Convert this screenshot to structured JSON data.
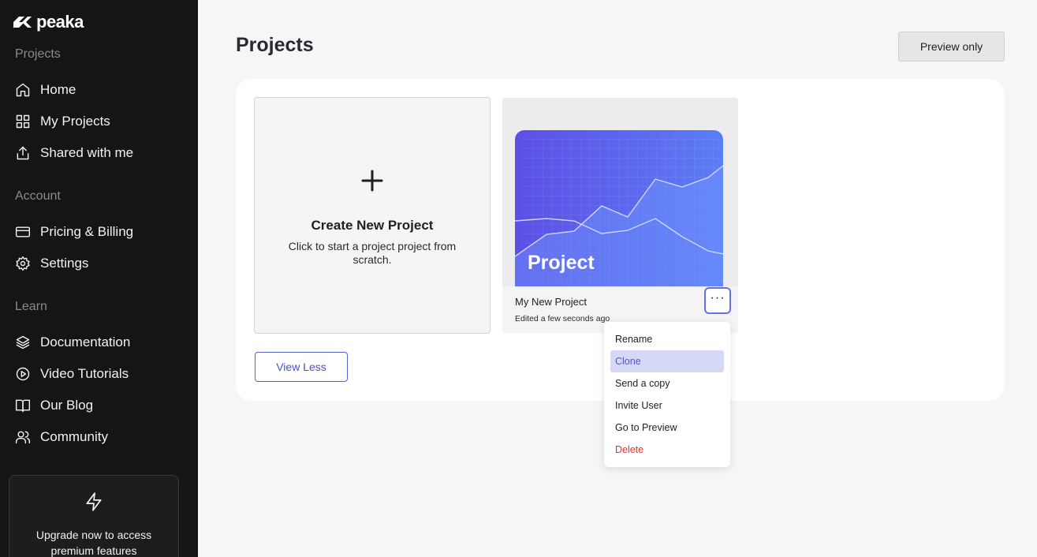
{
  "brand": {
    "name": "peaka"
  },
  "sidebar": {
    "sections": [
      {
        "title": "Projects",
        "items": [
          {
            "label": "Home",
            "icon": "home-icon"
          },
          {
            "label": "My Projects",
            "icon": "grid-icon"
          },
          {
            "label": "Shared with me",
            "icon": "share-icon"
          }
        ]
      },
      {
        "title": "Account",
        "items": [
          {
            "label": "Pricing & Billing",
            "icon": "credit-card-icon"
          },
          {
            "label": "Settings",
            "icon": "gear-icon"
          }
        ]
      },
      {
        "title": "Learn",
        "items": [
          {
            "label": "Documentation",
            "icon": "layers-icon"
          },
          {
            "label": "Video Tutorials",
            "icon": "play-circle-icon"
          },
          {
            "label": "Our Blog",
            "icon": "book-icon"
          },
          {
            "label": "Community",
            "icon": "users-icon"
          }
        ]
      }
    ],
    "upgrade": {
      "text": "Upgrade now to access premium features",
      "icon": "lightning-icon"
    }
  },
  "header": {
    "title": "Projects",
    "preview_button": "Preview only"
  },
  "create_card": {
    "title": "Create New Project",
    "description": "Click to start a project project from scratch."
  },
  "project_card": {
    "thumbnail_label": "Project",
    "name": "My New Project",
    "edited": "Edited a few seconds ago",
    "accent_color": "#5b5ff0"
  },
  "view_less_button": "View Less",
  "context_menu": {
    "items": [
      "Rename",
      "Clone",
      "Send a copy",
      "Invite User",
      "Go to Preview",
      "Delete"
    ],
    "highlighted": "Clone",
    "danger_item": "Delete"
  },
  "colors": {
    "sidebar_bg": "#151515",
    "accent": "#5b5fd4",
    "danger": "#e5332a"
  }
}
